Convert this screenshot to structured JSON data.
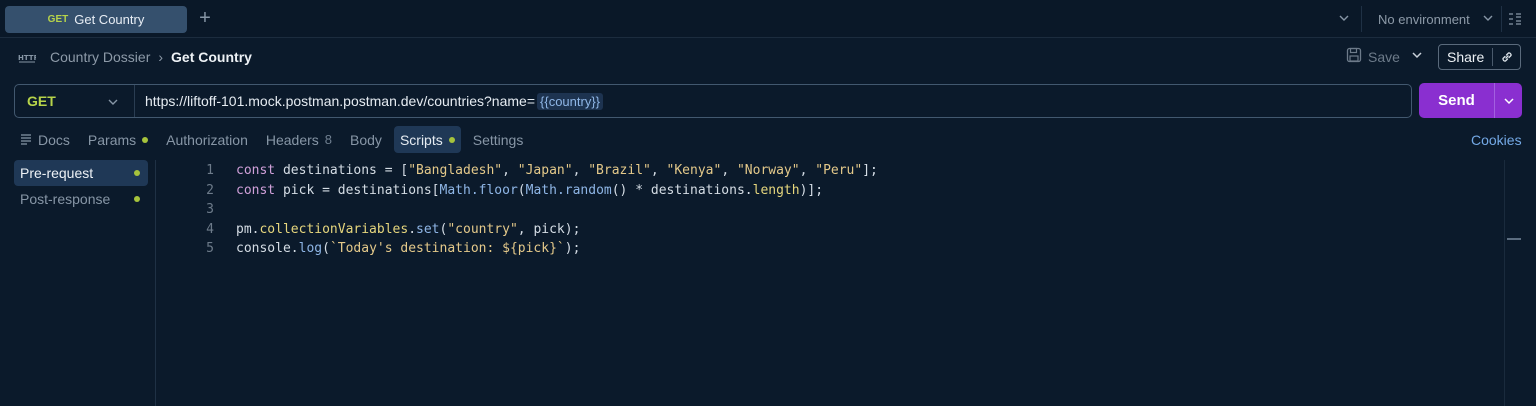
{
  "tab": {
    "method": "GET",
    "name": "Get Country"
  },
  "environment": {
    "label": "No environment"
  },
  "breadcrumb": {
    "collection": "Country Dossier",
    "separator": "›",
    "request": "Get Country"
  },
  "toolbar": {
    "save_label": "Save",
    "share_label": "Share"
  },
  "request": {
    "method": "GET",
    "url": "https://liftoff-101.mock.postman.postman.dev/countries?name=",
    "url_variable": "{{country}}",
    "send_label": "Send"
  },
  "req_tabs": [
    {
      "label": "Docs"
    },
    {
      "label": "Params"
    },
    {
      "label": "Authorization"
    },
    {
      "label": "Headers",
      "count": "8"
    },
    {
      "label": "Body"
    },
    {
      "label": "Scripts"
    },
    {
      "label": "Settings"
    }
  ],
  "cookies_label": "Cookies",
  "script_sections": [
    {
      "label": "Pre-request"
    },
    {
      "label": "Post-response"
    }
  ],
  "code_line_numbers": [
    "1",
    "2",
    "3",
    "4",
    "5"
  ],
  "code": {
    "l1": {
      "kw": "const",
      "var": " destinations = [",
      "s1": "\"Bangladesh\"",
      "s2": "\"Japan\"",
      "s3": "\"Brazil\"",
      "s4": "\"Kenya\"",
      "s5": "\"Norway\"",
      "s6": "\"Peru\"",
      "sep": ", ",
      "end": "];"
    },
    "l2": {
      "kw": "const",
      "a": " pick = destinations[",
      "math1": "Math",
      "floor": ".floor",
      "b": "(",
      "math2": "Math",
      "random": ".random",
      "c": "() * destinations.",
      "length": "length",
      "d": ")];"
    },
    "l4": {
      "a": "pm.",
      "prop": "collectionVariables",
      "dot": ".",
      "set": "set",
      "b": "(",
      "str": "\"country\"",
      "c": ", pick);"
    },
    "l5": {
      "a": "console.",
      "log": "log",
      "b": "(",
      "tpl": "`Today's destination: ${pick}`",
      "c": ");"
    }
  },
  "colors": {
    "accent": "#8a2fd0",
    "method_get": "#b7d44a",
    "status_dot": "#a6c33c",
    "link": "#74a9e6"
  }
}
